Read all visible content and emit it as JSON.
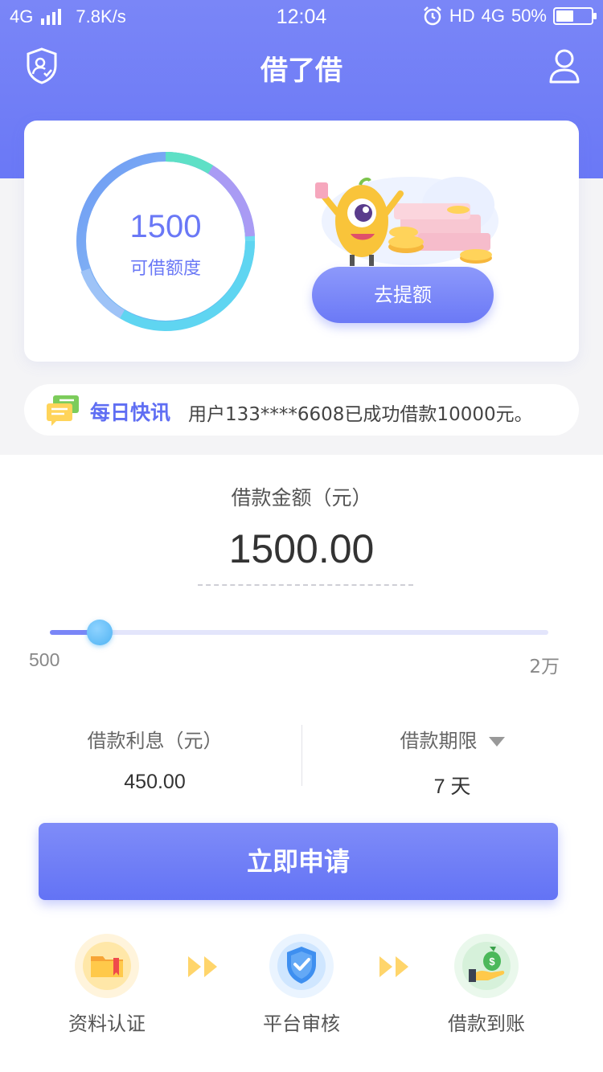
{
  "status_bar": {
    "network": "4G",
    "speed": "7.8K/s",
    "time": "12:04",
    "hd": "HD",
    "network_right": "4G",
    "battery": "50%",
    "battery_level": 0.5
  },
  "nav": {
    "title": "借了借",
    "left_icon": "shield-user-icon",
    "right_icon": "person-icon"
  },
  "quota": {
    "amount": "1500",
    "label": "可借额度",
    "raise_button": "去提额"
  },
  "news": {
    "title": "每日快讯",
    "text": "用户133****6608已成功借款10000元。"
  },
  "loan": {
    "amount_label": "借款金额（元）",
    "amount_value": "1500.00",
    "slider_min": "500",
    "slider_max": "2万",
    "slider_fraction": 0.1,
    "interest_label": "借款利息（元）",
    "interest_value": "450.00",
    "term_label": "借款期限",
    "term_value": "7 天",
    "apply_button": "立即申请"
  },
  "steps": [
    {
      "label": "资料认证",
      "icon": "folder-icon"
    },
    {
      "label": "平台审核",
      "icon": "shield-check-icon"
    },
    {
      "label": "借款到账",
      "icon": "money-bag-icon"
    }
  ],
  "colors": {
    "primary": "#6a78f6",
    "accent_blue": "#4fb3f3",
    "step_arrow": "#ffd56b"
  }
}
